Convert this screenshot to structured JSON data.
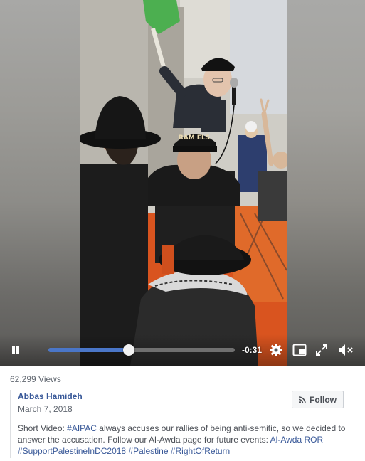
{
  "video": {
    "time_remaining": "-0:31",
    "progress_fraction": 0.43,
    "scene_text": "RAM ELS",
    "controls": {
      "play_state": "pause-icon",
      "settings": "gear-icon",
      "picture_in_picture": "pip-icon",
      "fullscreen": "expand-icon",
      "volume": "muted-speaker-icon"
    }
  },
  "post": {
    "views": "62,299 Views",
    "author": "Abbas Hamideh",
    "date": "March 7, 2018",
    "follow_label": "Follow",
    "description": {
      "prefix": "Short Video: ",
      "tag_aipac": "#AIPAC",
      "middle": " always accuses our rallies of being anti-semitic, so we decided to answer the accusation. Follow our Al-Awda page for future events: ",
      "page_link": "Al-Awda ROR",
      "tag_dc": "#SupportPalestineInDC2018",
      "tag_palestine": "#Palestine",
      "tag_return": "#RightOfReturn"
    }
  },
  "colors": {
    "link": "#385898",
    "progress_fill": "#4a76c8",
    "text_secondary": "#616770",
    "text_body": "#4b4f56"
  }
}
